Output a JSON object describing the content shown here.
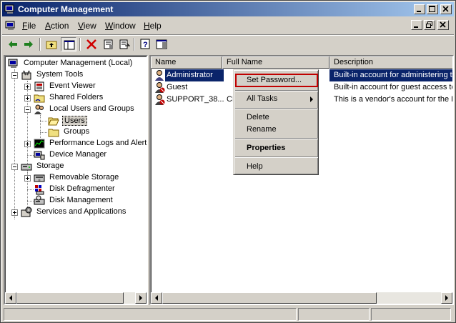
{
  "window": {
    "title": "Computer Management"
  },
  "menu": {
    "items": [
      {
        "label": "File",
        "u": "F",
        "rest": "ile"
      },
      {
        "label": "Action",
        "u": "A",
        "rest": "ction"
      },
      {
        "label": "View",
        "u": "V",
        "rest": "iew"
      },
      {
        "label": "Window",
        "u": "W",
        "rest": "indow"
      },
      {
        "label": "Help",
        "u": "H",
        "rest": "elp"
      }
    ]
  },
  "toolbar": {
    "icons": [
      "back-arrow-icon",
      "forward-arrow-icon",
      "up-folder-icon",
      "show-hide-tree-icon",
      "delete-icon",
      "properties-icon",
      "export-list-icon",
      "help-icon",
      "show-hide-action-pane-icon"
    ]
  },
  "tree": {
    "root": "Computer Management (Local)",
    "system_tools": "System Tools",
    "event_viewer": "Event Viewer",
    "shared_folders": "Shared Folders",
    "local_users_groups": "Local Users and Groups",
    "users": "Users",
    "groups": "Groups",
    "perf_logs": "Performance Logs and Alerts",
    "device_manager": "Device Manager",
    "storage": "Storage",
    "removable_storage": "Removable Storage",
    "disk_defrag": "Disk Defragmenter",
    "disk_management": "Disk Management",
    "services_apps": "Services and Applications"
  },
  "list": {
    "columns": [
      "Name",
      "Full Name",
      "Description"
    ],
    "rows": [
      {
        "name": "Administrator",
        "full_name": "",
        "description": "Built-in account for administering th",
        "selected": true
      },
      {
        "name": "Guest",
        "full_name": "",
        "description": "Built-in account for guest access to"
      },
      {
        "name": "SUPPORT_38...",
        "full_name": "CN",
        "description": "This is a vendor's account for the H"
      }
    ]
  },
  "context_menu": {
    "set_password": "Set Password...",
    "all_tasks": "All Tasks",
    "delete": "Delete",
    "rename": "Rename",
    "properties": "Properties",
    "help": "Help",
    "highlight_color": "#c00000"
  },
  "colors": {
    "selection": "#0a246a",
    "titlebar_start": "#0a246a",
    "titlebar_end": "#a6caf0"
  }
}
